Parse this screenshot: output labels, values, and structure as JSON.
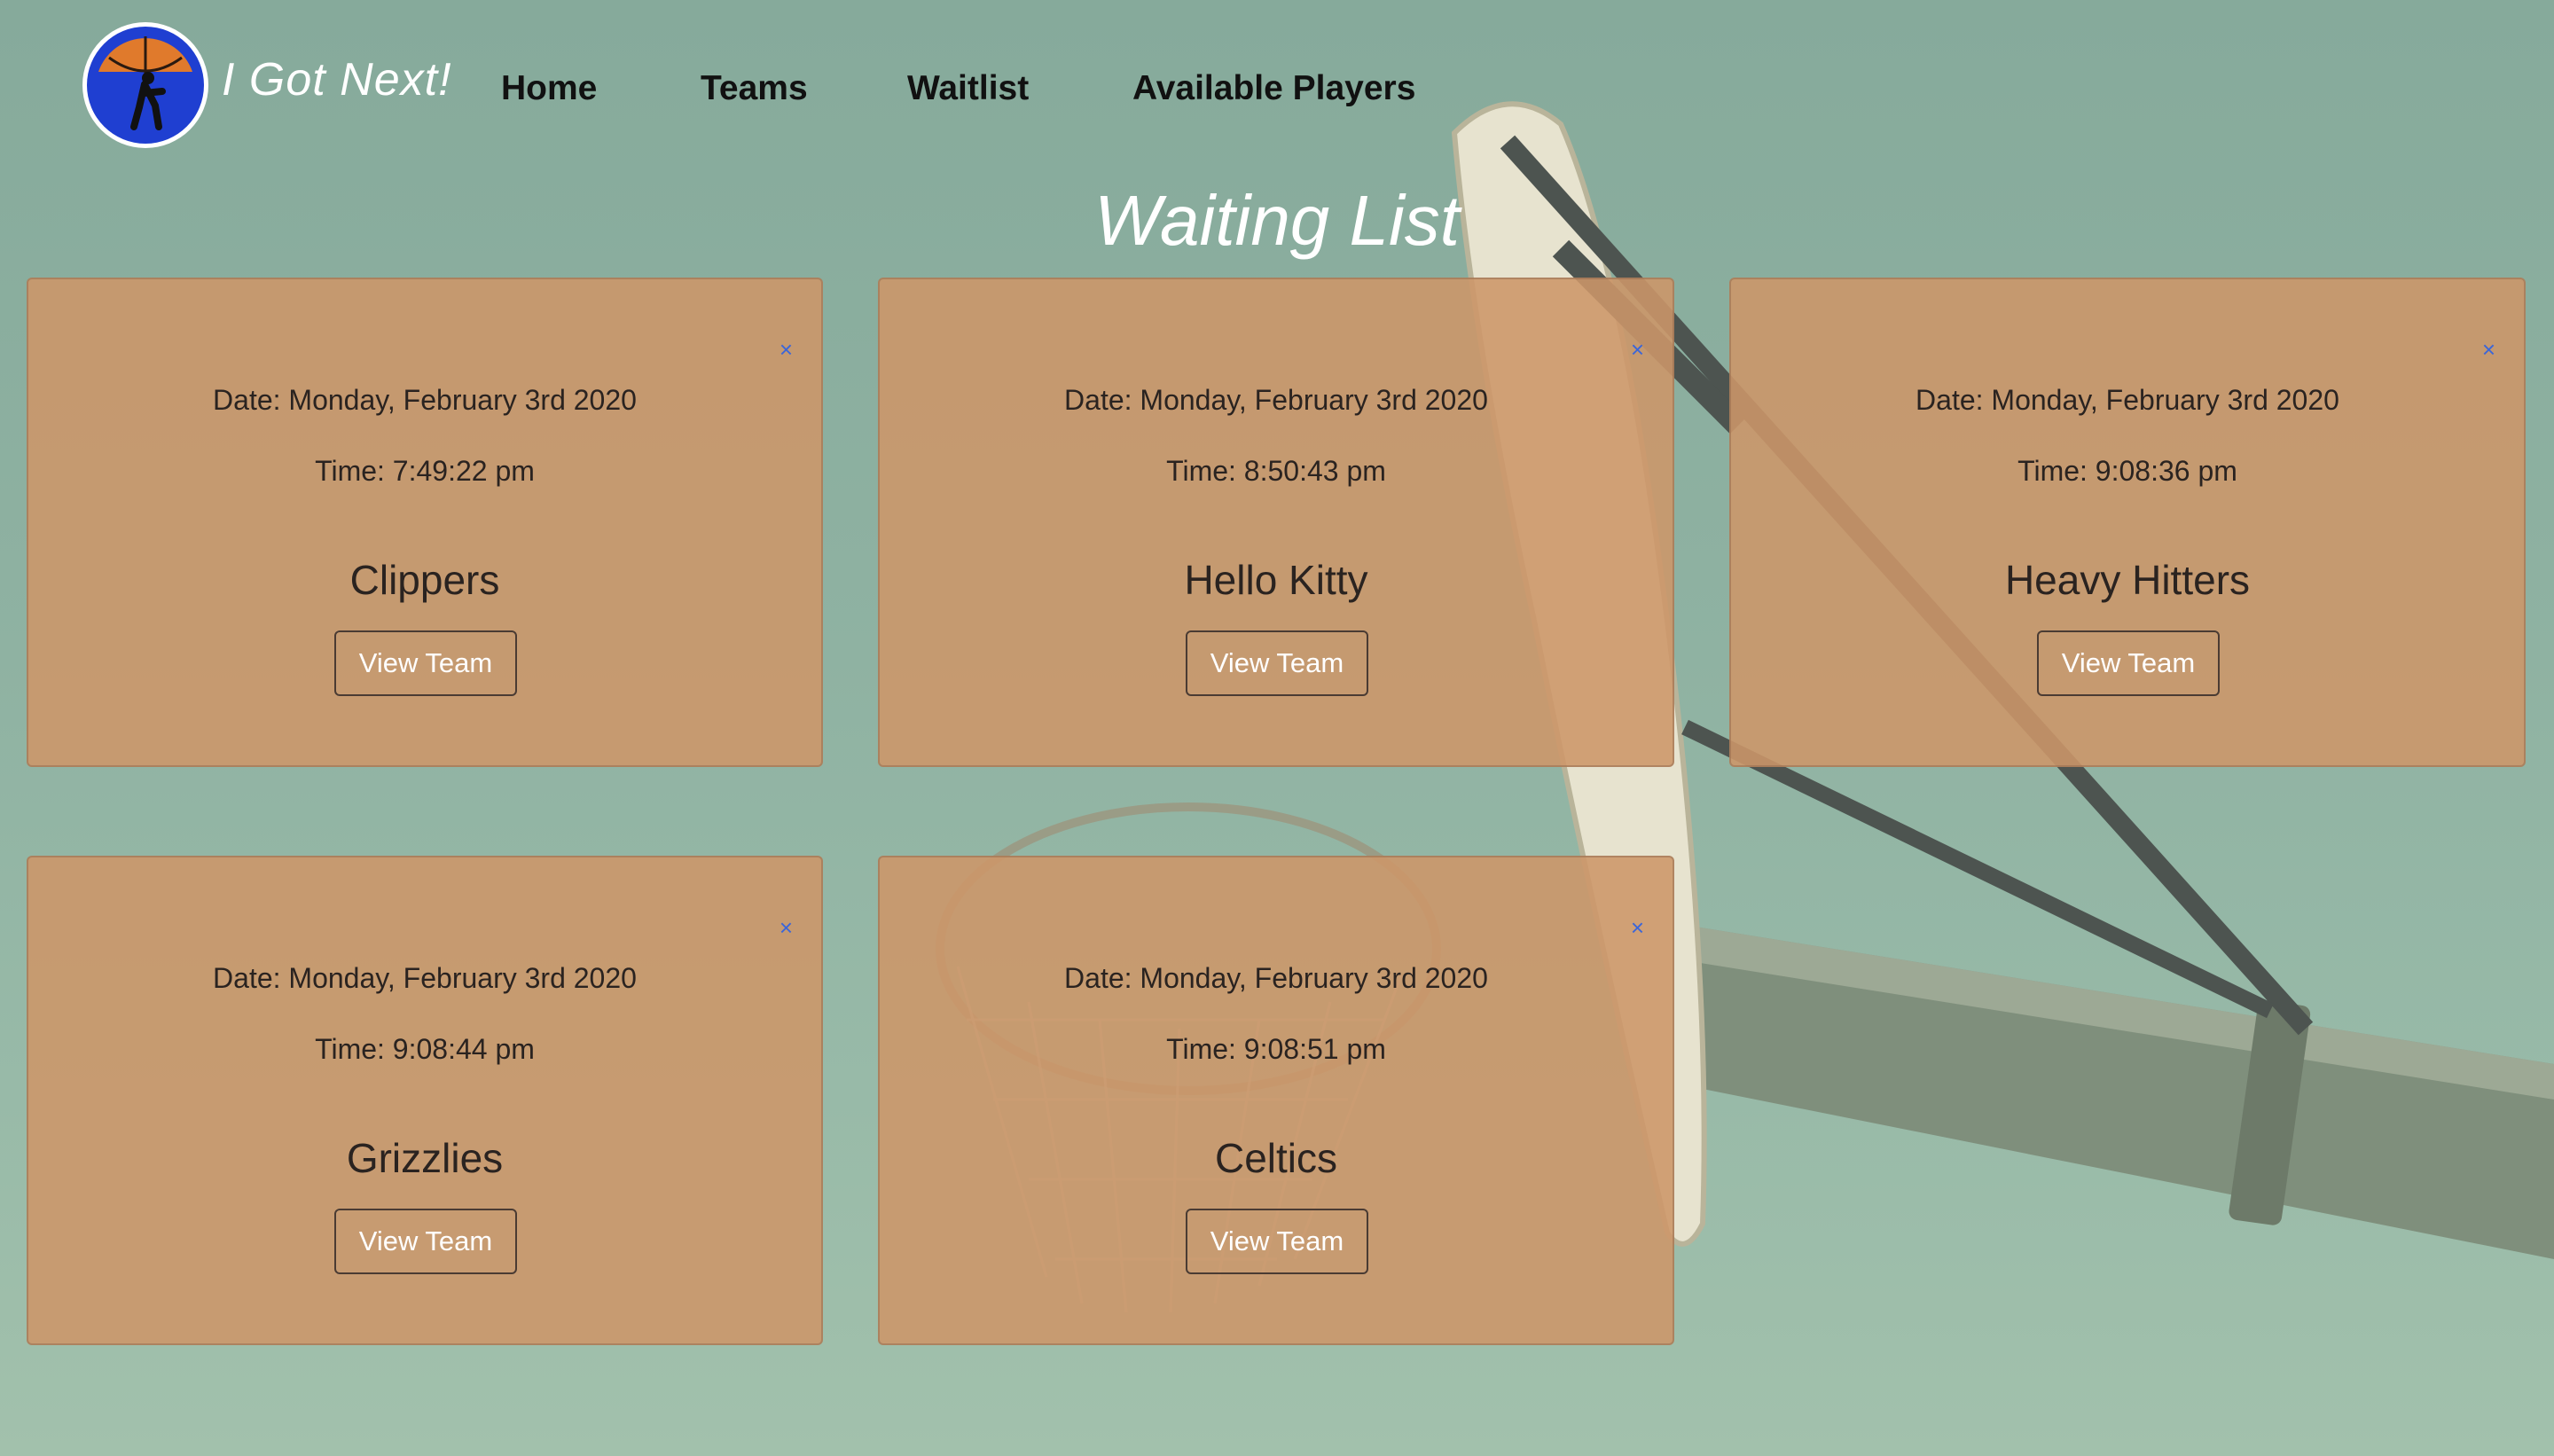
{
  "brand": {
    "name": "I Got Next!",
    "logo_text": "I GOT NEXT"
  },
  "nav": {
    "home": "Home",
    "teams": "Teams",
    "waitlist": "Waitlist",
    "available_players": "Available Players"
  },
  "page": {
    "title": "Waiting List"
  },
  "cards": [
    {
      "date": "Date: Monday, February 3rd 2020",
      "time": "Time: 7:49:22 pm",
      "team": "Clippers",
      "button": "View Team",
      "close": "×"
    },
    {
      "date": "Date: Monday, February 3rd 2020",
      "time": "Time: 8:50:43 pm",
      "team": "Hello Kitty",
      "button": "View Team",
      "close": "×"
    },
    {
      "date": "Date: Monday, February 3rd 2020",
      "time": "Time: 9:08:36 pm",
      "team": "Heavy Hitters",
      "button": "View Team",
      "close": "×"
    },
    {
      "date": "Date: Monday, February 3rd 2020",
      "time": "Time: 9:08:44 pm",
      "team": "Grizzlies",
      "button": "View Team",
      "close": "×"
    },
    {
      "date": "Date: Monday, February 3rd 2020",
      "time": "Time: 9:08:51 pm",
      "team": "Celtics",
      "button": "View Team",
      "close": "×"
    }
  ],
  "icons": {
    "logo": "basketball-player-logo-icon",
    "close": "close-icon"
  },
  "colors": {
    "card_background": "#cd9669",
    "close_icon": "#3b66d9",
    "logo_ring": "#1f3fd1",
    "logo_ball": "#e07a2c"
  }
}
